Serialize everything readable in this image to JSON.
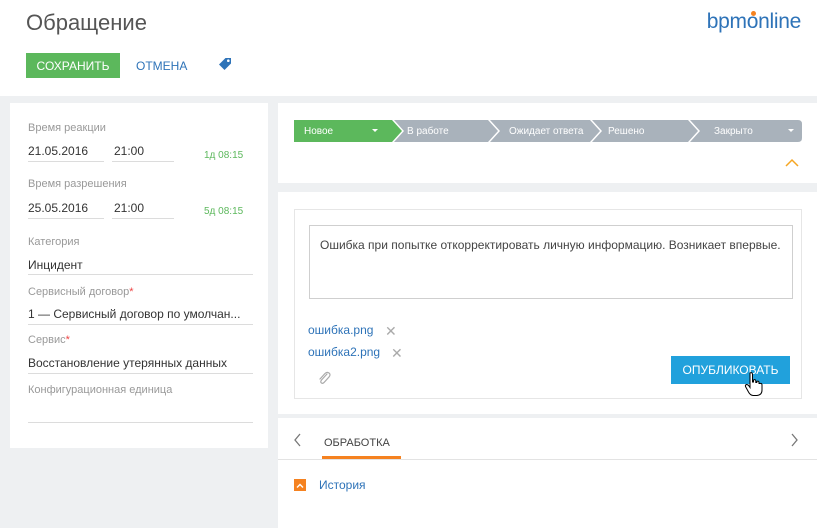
{
  "header": {
    "title": "Обращение",
    "logo": {
      "brand": "bpm",
      "o": "o",
      "rest": "nline"
    },
    "save_label": "СОХРАНИТЬ",
    "cancel_label": "ОТМЕНА"
  },
  "left_panel": {
    "reaction": {
      "label": "Время реакции",
      "date": "21.05.2016",
      "time": "21:00",
      "remaining": "1д 08:15"
    },
    "resolution": {
      "label": "Время разрешения",
      "date": "25.05.2016",
      "time": "21:00",
      "remaining": "5д 08:15"
    },
    "category": {
      "label": "Категория",
      "value": "Инцидент"
    },
    "contract": {
      "label": "Сервисный договор",
      "required_mark": "*",
      "value": "1 — Сервисный договор по умолчан..."
    },
    "service": {
      "label": "Сервис",
      "required_mark": "*",
      "value": "Восстановление утерянных данных"
    },
    "config_item": {
      "label": "Конфигурационная единица",
      "value": ""
    }
  },
  "stages": [
    {
      "label": "Новое",
      "active": true
    },
    {
      "label": "В работе",
      "active": false
    },
    {
      "label": "Ожидает ответа",
      "active": false
    },
    {
      "label": "Решено",
      "active": false
    },
    {
      "label": "Закрыто",
      "active": false
    }
  ],
  "post": {
    "text": "Ошибка при попытке откорректировать личную информацию. Возникает впервые.",
    "attachments": [
      "ошибка.png",
      "ошибка2.png"
    ],
    "remove_glyph": "✕",
    "publish_label": "ОПУБЛИКОВАТЬ"
  },
  "tabs": {
    "active": "ОБРАБОТКА",
    "history_label": "История"
  },
  "colors": {
    "accent_green": "#5cb85c",
    "accent_blue": "#21a1dc",
    "link_blue": "#2e73b8",
    "accent_orange": "#f58220",
    "stage_inactive": "#a9b2bb"
  }
}
